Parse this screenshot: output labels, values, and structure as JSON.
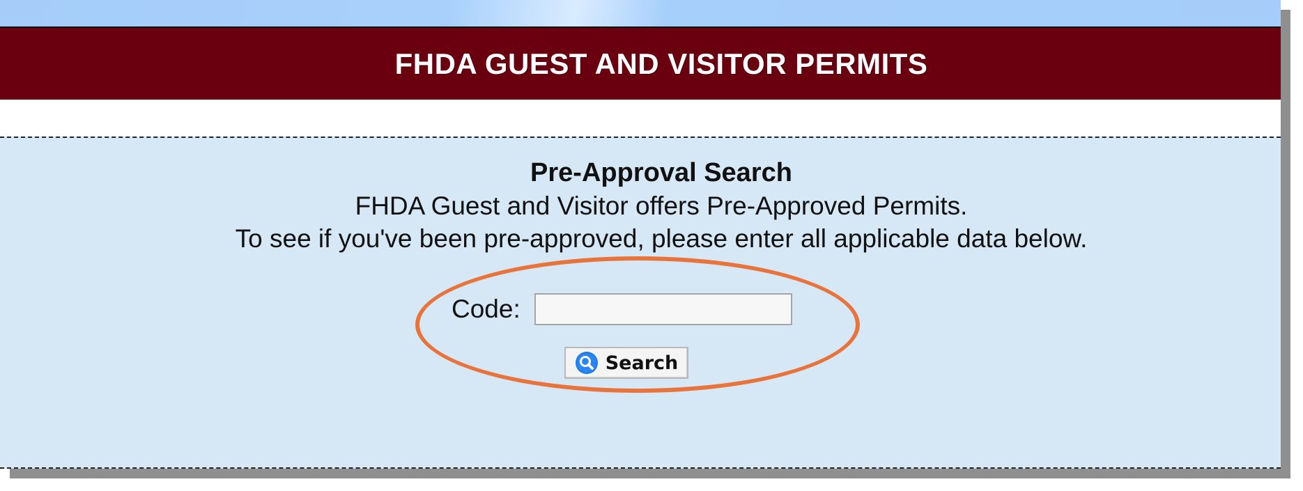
{
  "header": {
    "title": "FHDA GUEST AND VISITOR PERMITS"
  },
  "search_panel": {
    "title": "Pre-Approval Search",
    "line1": "FHDA Guest and Visitor offers Pre-Approved Permits.",
    "line2": "To see if you've been pre-approved, please enter all applicable data below.",
    "code_label": "Code:",
    "code_value": "",
    "search_button_label": "Search",
    "search_icon": "magnifier-icon"
  },
  "colors": {
    "header_background": "#6a000f",
    "panel_background": "#d6e7f6",
    "top_strip": "#a6cdf9",
    "highlight": "#e8743b",
    "search_icon_blue": "#1f78e8"
  }
}
